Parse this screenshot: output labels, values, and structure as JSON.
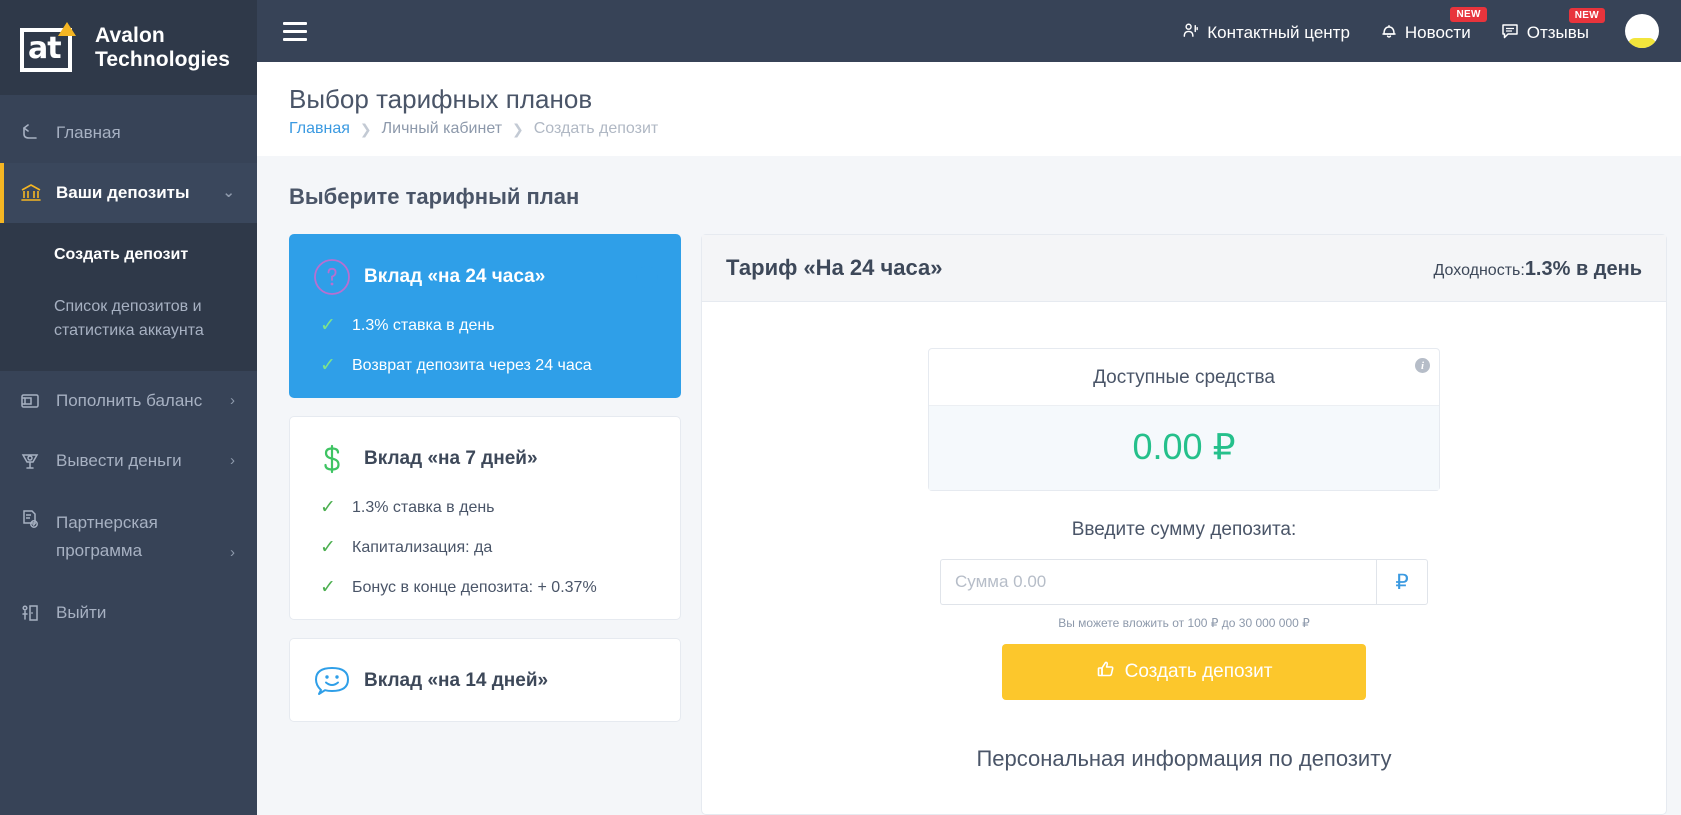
{
  "brand": {
    "logo_letters": "at",
    "name_line1": "Avalon",
    "name_line2": "Technologies"
  },
  "topbar": {
    "menu_toggle": "menu-toggle",
    "links": [
      {
        "label": "Контактный центр",
        "icon": "contact-center-icon",
        "badge": null
      },
      {
        "label": "Новости",
        "icon": "bell-icon",
        "badge": "NEW"
      },
      {
        "label": "Отзывы",
        "icon": "comment-icon",
        "badge": "NEW"
      }
    ]
  },
  "sidebar": {
    "items": [
      {
        "label": "Главная",
        "icon": "back-arrow-icon",
        "arrow": "",
        "active": false
      },
      {
        "label": "Ваши депозиты",
        "icon": "bank-icon",
        "arrow": "⌄",
        "active": true
      },
      {
        "label": "Пополнить баланс",
        "icon": "wallet-icon",
        "arrow": "›",
        "active": false
      },
      {
        "label": "Вывести деньги",
        "icon": "withdraw-icon",
        "arrow": "›",
        "active": false
      },
      {
        "label": "Партнерская программа",
        "icon": "affiliate-doc-icon",
        "arrow": "›",
        "active": false
      },
      {
        "label": "Выйти",
        "icon": "logout-icon",
        "arrow": "",
        "active": false
      }
    ],
    "submenu": [
      {
        "label": "Создать депозит",
        "current": true
      },
      {
        "label": "Список депозитов и статистика аккаунта",
        "current": false
      }
    ]
  },
  "page": {
    "title": "Выбор тарифных планов",
    "breadcrumb": [
      {
        "label": "Главная",
        "type": "link"
      },
      {
        "label": "Личный кабинет",
        "type": "mid"
      },
      {
        "label": "Создать депозит",
        "type": "current"
      }
    ],
    "section_title": "Выберите тарифный план"
  },
  "tariffs": [
    {
      "name": "Вклад «на 24 часа»",
      "icon": "question-circle-icon",
      "selected": true,
      "features": [
        "1.3% ставка в день",
        "Возврат депозита через 24 часа"
      ]
    },
    {
      "name": "Вклад «на 7 дней»",
      "icon": "dollar-icon",
      "selected": false,
      "features": [
        "1.3% ставка в день",
        "Капитализация: да",
        "Бонус в конце депозита: + 0.37%"
      ]
    },
    {
      "name": "Вклад «на 14 дней»",
      "icon": "smiley-chat-icon",
      "selected": false,
      "features": []
    }
  ],
  "detail": {
    "title": "Тариф «На 24 часа»",
    "yield_label": "Доходность:",
    "yield_value": "1.3% в день",
    "balance_title": "Доступные средства",
    "balance_value": "0.00 ₽",
    "info_icon_label": "i",
    "enter_amount_label": "Введите сумму депозита:",
    "amount_placeholder": "Сумма 0.00",
    "amount_value": "",
    "currency_symbol": "₽",
    "limits_note": "Вы можете вложить от 100 ₽ до 30 000 000 ₽",
    "create_button": "Создать депозит",
    "personal_info_title": "Персональная информация по депозиту"
  },
  "colors": {
    "sidebar": "#374357",
    "accent_blue": "#2f9fe8",
    "accent_yellow": "#fcc72c",
    "balance_green": "#25c08b",
    "badge_red": "#e8343c"
  }
}
